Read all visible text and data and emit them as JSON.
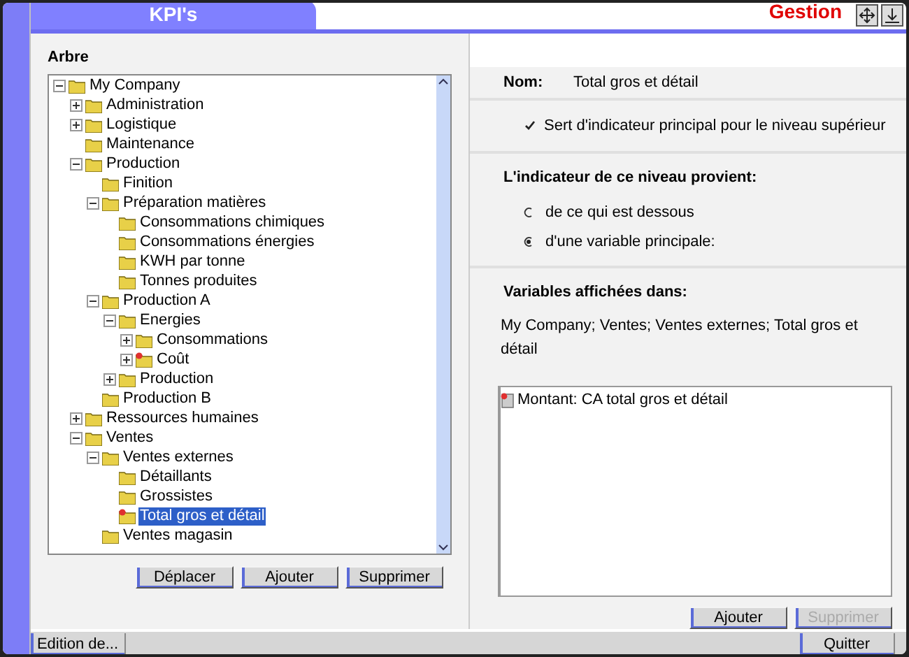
{
  "header": {
    "tab": "KPI's",
    "section": "Gestion"
  },
  "tree": {
    "title": "Arbre",
    "items": [
      {
        "label": "My Company",
        "expanded": true,
        "selected": false,
        "children": [
          {
            "label": "Administration",
            "expanded": false,
            "selected": false
          },
          {
            "label": "Logistique",
            "expanded": false,
            "selected": false
          },
          {
            "label": "Maintenance",
            "selected": false
          },
          {
            "label": "Production",
            "expanded": true,
            "selected": false,
            "children": [
              {
                "label": "Finition",
                "selected": false
              },
              {
                "label": "Préparation matières",
                "expanded": true,
                "selected": false,
                "children": [
                  {
                    "label": "Consommations chimiques",
                    "selected": false
                  },
                  {
                    "label": "Consommations énergies",
                    "selected": false
                  },
                  {
                    "label": "KWH par tonne",
                    "selected": false
                  },
                  {
                    "label": "Tonnes produites",
                    "selected": false
                  }
                ]
              },
              {
                "label": "Production A",
                "expanded": true,
                "selected": false,
                "children": [
                  {
                    "label": "Energies",
                    "expanded": true,
                    "selected": false,
                    "children": [
                      {
                        "label": "Consommations",
                        "expanded": false,
                        "selected": false
                      },
                      {
                        "label": "Coût",
                        "expanded": false,
                        "selected": false,
                        "flagged": true
                      }
                    ]
                  },
                  {
                    "label": "Production",
                    "expanded": false,
                    "selected": false
                  }
                ]
              },
              {
                "label": "Production B",
                "selected": false
              }
            ]
          },
          {
            "label": "Ressources humaines",
            "expanded": false,
            "selected": false
          },
          {
            "label": "Ventes",
            "expanded": true,
            "selected": false,
            "children": [
              {
                "label": "Ventes externes",
                "expanded": true,
                "selected": false,
                "children": [
                  {
                    "label": "Détaillants",
                    "selected": false
                  },
                  {
                    "label": "Grossistes",
                    "selected": false
                  },
                  {
                    "label": "Total gros et détail",
                    "selected": true,
                    "flagged": true
                  }
                ]
              },
              {
                "label": "Ventes magasin",
                "selected": false
              }
            ]
          }
        ]
      }
    ],
    "buttons": [
      {
        "label": "Déplacer",
        "disabled": false
      },
      {
        "label": "Ajouter",
        "disabled": false
      },
      {
        "label": "Supprimer",
        "disabled": false
      }
    ]
  },
  "details": {
    "name_label": "Nom:",
    "name_value": "Total gros et détail",
    "principal": {
      "label": "Sert d'indicateur principal pour le niveau supérieur",
      "checked": true
    },
    "source_title": "L'indicateur de ce niveau provient:",
    "source_options": [
      {
        "label": "de ce qui est dessous",
        "selected": false
      },
      {
        "label": "d'une variable principale:",
        "selected": true
      }
    ],
    "variables_title": "Variables affichées dans:",
    "variables_path": "My Company; Ventes; Ventes externes; Total gros et détail",
    "variables": [
      {
        "label": "Montant: CA total gros et détail"
      }
    ],
    "buttons": [
      {
        "label": "Ajouter",
        "disabled": false
      },
      {
        "label": "Supprimer",
        "disabled": true
      }
    ]
  },
  "footer": {
    "left_button": "Edition de...",
    "right_button": "Quitter"
  }
}
